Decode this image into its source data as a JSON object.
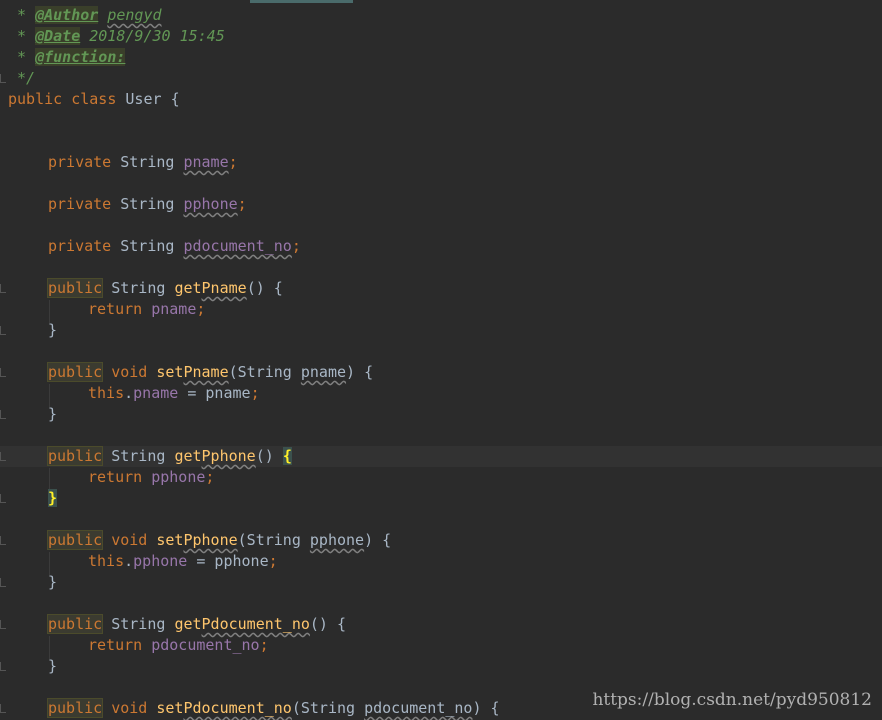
{
  "editor": {
    "comment": {
      "star": " * ",
      "author_tag": "@Author",
      "author_val": "pengyd",
      "date_tag": "@Date",
      "date_val": "2018/9/30 15:45",
      "function_tag": "@function:",
      "close": " */"
    },
    "class_decl": {
      "kw_public": "public",
      "kw_class": "class",
      "name": "User",
      "open": "{"
    },
    "fields": [
      {
        "kw": "private",
        "type": "String",
        "name": "pname",
        "semi": ";"
      },
      {
        "kw": "private",
        "type": "String",
        "name": "pphone",
        "semi": ";"
      },
      {
        "kw": "private",
        "type": "String",
        "name": "pdocument_no",
        "semi": ";"
      }
    ],
    "methods": {
      "m1_sig_kw": "public",
      "m1_sig_type": "String",
      "m1_prefix": "get",
      "m1_name": "Pname",
      "m1_params": "() {",
      "m1_ret": "return",
      "m1_retval": "pname",
      "m1_semi": ";",
      "close": "}",
      "m2_sig_kw": "public",
      "m2_sig_type": "void",
      "m2_prefix": "set",
      "m2_name": "Pname",
      "m2_open": "(String ",
      "m2_param": "pname",
      "m2_close": ") {",
      "m2_this": "this",
      "m2_dot": ".",
      "m2_field": "pname",
      "m2_eq": " = pname",
      "m2_semi": ";",
      "m3_sig_kw": "public",
      "m3_sig_type": "String",
      "m3_prefix": "get",
      "m3_name": "Pphone",
      "m3_paren": "() ",
      "m3_brace": "{",
      "m3_ret": "return",
      "m3_retval": "pphone",
      "m3_semi": ";",
      "m3_close": "}",
      "m4_sig_kw": "public",
      "m4_sig_type": "void",
      "m4_prefix": "set",
      "m4_name": "Pphone",
      "m4_open": "(String ",
      "m4_param": "pphone",
      "m4_close": ") {",
      "m4_this": "this",
      "m4_dot": ".",
      "m4_field": "pphone",
      "m4_eq": " = pphone",
      "m4_semi": ";",
      "m5_sig_kw": "public",
      "m5_sig_type": "String",
      "m5_prefix": "get",
      "m5_name": "Pdocument_no",
      "m5_params": "() {",
      "m5_ret": "return",
      "m5_retval": "pdocument_no",
      "m5_semi": ";",
      "m6_sig_kw": "public",
      "m6_sig_type": "void",
      "m6_prefix": "set",
      "m6_name": "Pdocument_no",
      "m6_open": "(String ",
      "m6_param": "pdocument_no",
      "m6_close": ") {"
    }
  },
  "watermark": "https://blog.csdn.net/pyd950812"
}
